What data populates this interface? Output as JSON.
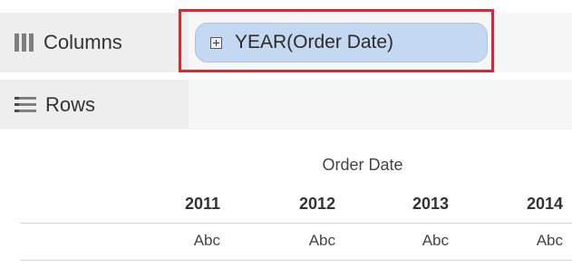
{
  "shelves": {
    "columns": {
      "label": "Columns",
      "icon": "columns-icon",
      "pill": {
        "label": "YEAR(Order Date)",
        "icon": "expand-plus-icon",
        "color": "#c5d8f1"
      }
    },
    "rows": {
      "label": "Rows",
      "icon": "rows-icon"
    }
  },
  "highlight_color": "#e0262a",
  "view": {
    "column_header": "Order Date",
    "years": [
      "2011",
      "2012",
      "2013",
      "2014"
    ],
    "cells": [
      "Abc",
      "Abc",
      "Abc",
      "Abc"
    ]
  }
}
